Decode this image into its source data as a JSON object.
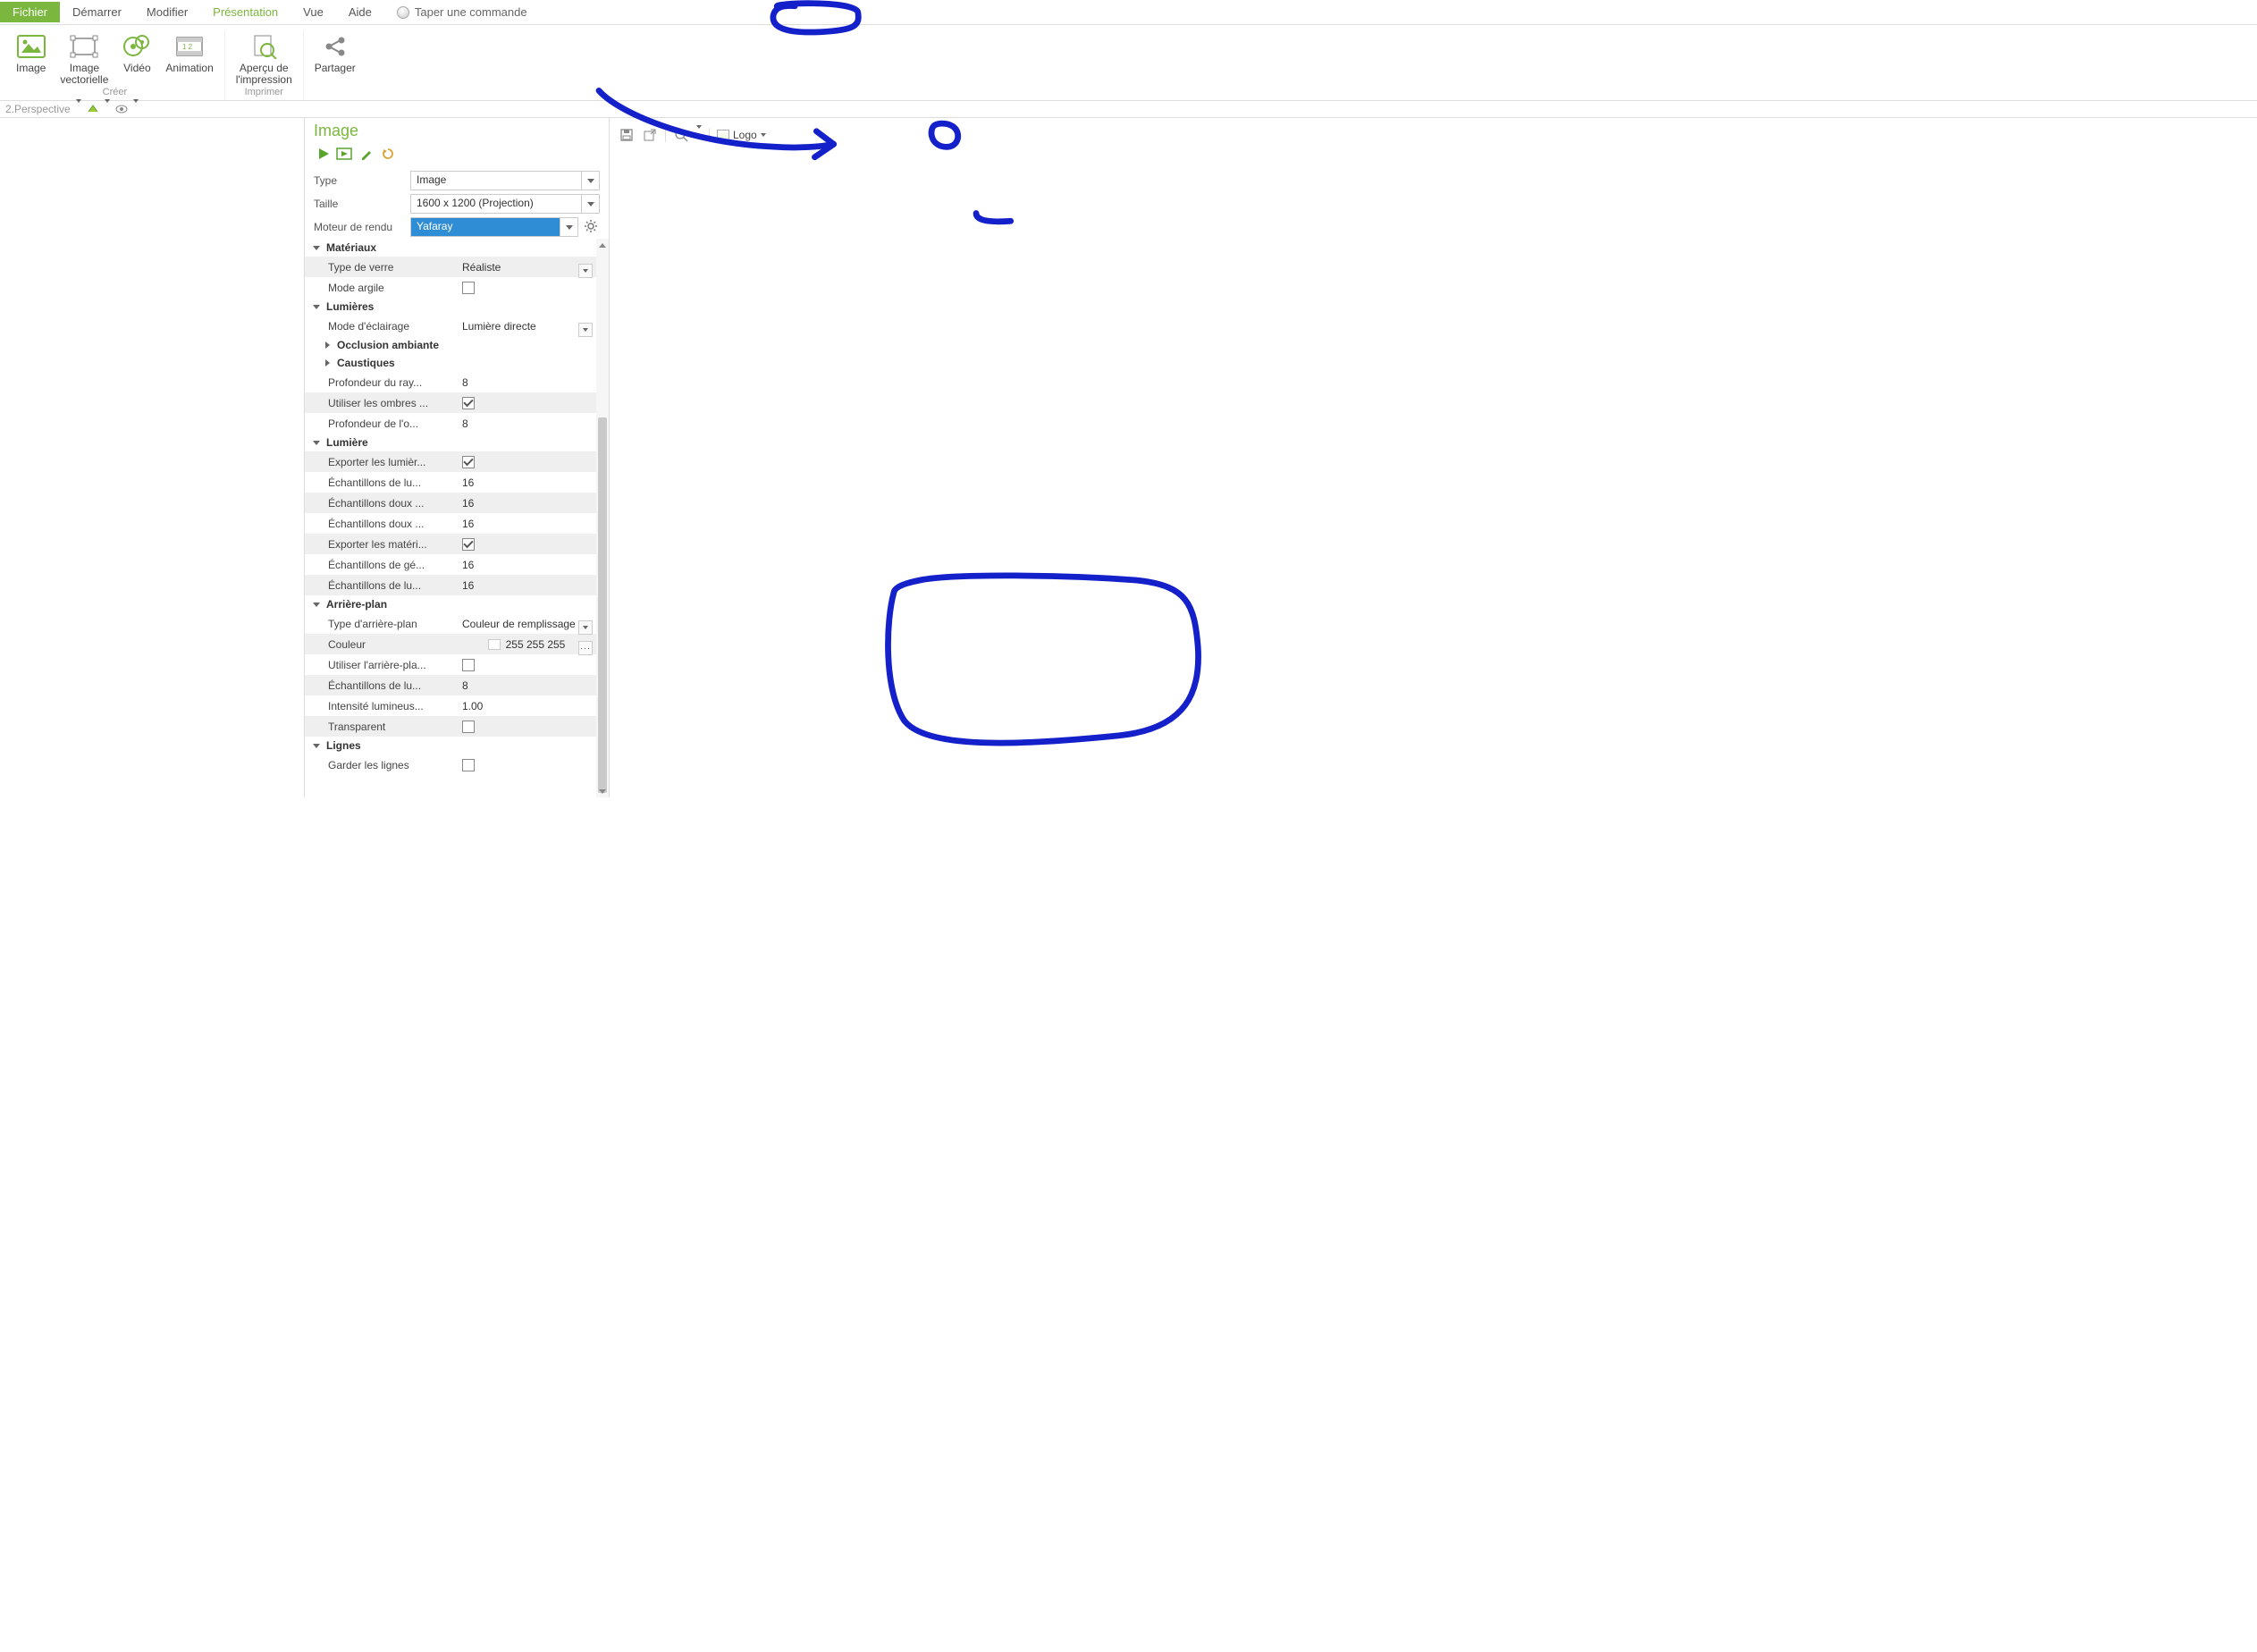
{
  "menu": {
    "fichier": "Fichier",
    "demarrer": "Démarrer",
    "modifier": "Modifier",
    "presentation": "Présentation",
    "vue": "Vue",
    "aide": "Aide",
    "command_placeholder": "Taper une commande"
  },
  "ribbon": {
    "image": "Image",
    "image_vectorielle": "Image\nvectorielle",
    "video": "Vidéo",
    "animation": "Animation",
    "apercu_impression": "Aperçu de\nl'impression",
    "partager": "Partager",
    "group_creer": "Créer",
    "group_imprimer": "Imprimer"
  },
  "perspective": {
    "label": "2.Perspective"
  },
  "panel": {
    "title": "Image",
    "type_label": "Type",
    "type_value": "Image",
    "taille_label": "Taille",
    "taille_value": "1600 x 1200 (Projection)",
    "moteur_label": "Moteur de rendu",
    "moteur_value": "Yafaray"
  },
  "props": {
    "materiaux": {
      "head": "Matériaux",
      "type_verre_label": "Type de verre",
      "type_verre_value": "Réaliste",
      "mode_argile_label": "Mode argile"
    },
    "lumieres": {
      "head": "Lumières",
      "mode_eclairage_label": "Mode d'éclairage",
      "mode_eclairage_value": "Lumière directe",
      "occlusion_head": "Occlusion ambiante",
      "caustiques_head": "Caustiques",
      "prof_rayon_label": "Profondeur du ray...",
      "prof_rayon_value": "8",
      "utiliser_ombres_label": "Utiliser les ombres ...",
      "prof_ombre_label": "Profondeur de l'o...",
      "prof_ombre_value": "8"
    },
    "lumiere": {
      "head": "Lumière",
      "exporter_lum_label": "Exporter les lumièr...",
      "ech_lum_label": "Échantillons de lu...",
      "ech_lum_value": "16",
      "ech_doux1_label": "Échantillons doux ...",
      "ech_doux1_value": "16",
      "ech_doux2_label": "Échantillons doux ...",
      "ech_doux2_value": "16",
      "exporter_mat_label": "Exporter les matéri...",
      "ech_ge_label": "Échantillons de gé...",
      "ech_ge_value": "16",
      "ech_lu2_label": "Échantillons de lu...",
      "ech_lu2_value": "16"
    },
    "arriere": {
      "head": "Arrière-plan",
      "type_label": "Type d'arrière-plan",
      "type_value": "Couleur de remplissage",
      "couleur_label": "Couleur",
      "couleur_value": "255 255 255",
      "utiliser_label": "Utiliser l'arrière-pla...",
      "ech_label": "Échantillons de lu...",
      "ech_value": "8",
      "intensite_label": "Intensité lumineus...",
      "intensite_value": "1.00",
      "transparent_label": "Transparent"
    },
    "lignes": {
      "head": "Lignes",
      "garder_label": "Garder les lignes"
    }
  },
  "preview": {
    "logo_label": "Logo"
  }
}
